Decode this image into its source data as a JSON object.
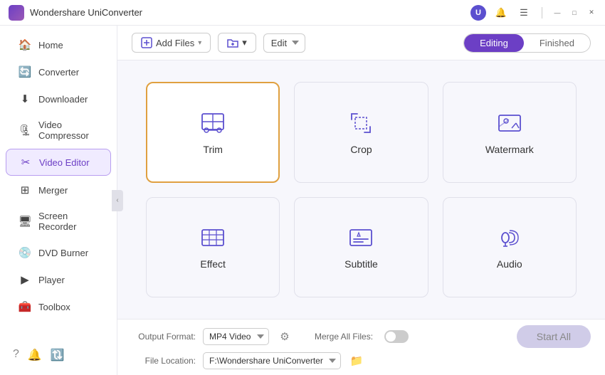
{
  "app": {
    "title": "Wondershare UniConverter",
    "user_initial": "U"
  },
  "titlebar": {
    "title": "Wondershare UniConverter",
    "minimize": "—",
    "maximize": "□",
    "close": "✕"
  },
  "sidebar": {
    "items": [
      {
        "id": "home",
        "label": "Home",
        "icon": "🏠"
      },
      {
        "id": "converter",
        "label": "Converter",
        "icon": "🔄"
      },
      {
        "id": "downloader",
        "label": "Downloader",
        "icon": "⬇"
      },
      {
        "id": "video-compressor",
        "label": "Video Compressor",
        "icon": "🗜"
      },
      {
        "id": "video-editor",
        "label": "Video Editor",
        "icon": "✂",
        "active": true
      },
      {
        "id": "merger",
        "label": "Merger",
        "icon": "⊞"
      },
      {
        "id": "screen-recorder",
        "label": "Screen Recorder",
        "icon": "🖥"
      },
      {
        "id": "dvd-burner",
        "label": "DVD Burner",
        "icon": "💿"
      },
      {
        "id": "player",
        "label": "Player",
        "icon": "▶"
      },
      {
        "id": "toolbox",
        "label": "Toolbox",
        "icon": "🧰"
      }
    ],
    "bottom_icons": [
      "?",
      "🔔",
      "🔃"
    ]
  },
  "toolbar": {
    "add_files_label": "Add Files",
    "add_folder_label": "Add Folder",
    "edit_label": "Edit",
    "tab_editing": "Editing",
    "tab_finished": "Finished"
  },
  "editor": {
    "cards": [
      {
        "id": "trim",
        "label": "Trim",
        "selected": true
      },
      {
        "id": "crop",
        "label": "Crop",
        "selected": false
      },
      {
        "id": "watermark",
        "label": "Watermark",
        "selected": false
      },
      {
        "id": "effect",
        "label": "Effect",
        "selected": false
      },
      {
        "id": "subtitle",
        "label": "Subtitle",
        "selected": false
      },
      {
        "id": "audio",
        "label": "Audio",
        "selected": false
      }
    ]
  },
  "bottom": {
    "output_format_label": "Output Format:",
    "output_format_value": "MP4 Video",
    "file_location_label": "File Location:",
    "file_location_value": "F:\\Wondershare UniConverter",
    "merge_label": "Merge All Files:",
    "start_all_label": "Start All"
  }
}
